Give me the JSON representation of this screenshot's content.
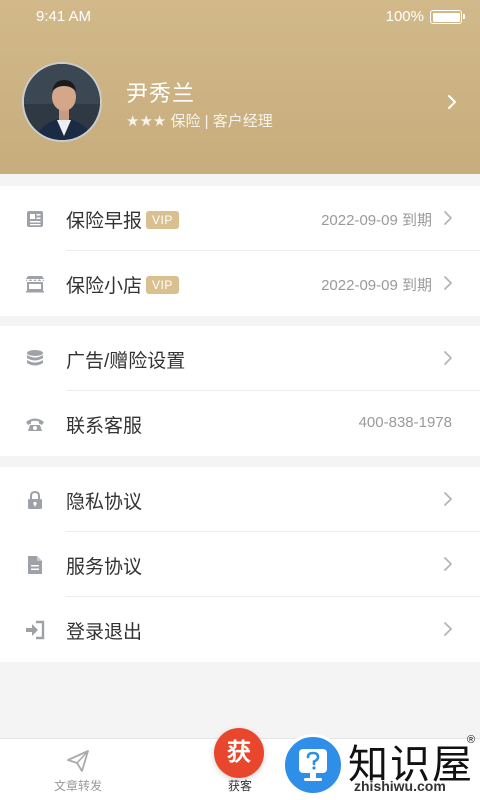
{
  "status_bar": {
    "time": "9:41 AM",
    "battery": "100%",
    "battery_level": 1.0
  },
  "profile": {
    "name": "尹秀兰",
    "subtitle": "★★★ 保险 | 客户经理"
  },
  "sections": [
    {
      "items": [
        {
          "label": "保险早报",
          "badge": "VIP",
          "value": "2022-09-09 到期",
          "icon": "newspaper-icon"
        },
        {
          "label": "保险小店",
          "badge": "VIP",
          "value": "2022-09-09 到期",
          "icon": "store-icon"
        }
      ]
    },
    {
      "items": [
        {
          "label": "广告/赠险设置",
          "icon": "database-icon"
        },
        {
          "label": "联系客服",
          "value": "400-838-1978",
          "icon": "phone-icon"
        }
      ]
    },
    {
      "items": [
        {
          "label": "隐私协议",
          "icon": "lock-icon"
        },
        {
          "label": "服务协议",
          "icon": "document-icon"
        },
        {
          "label": "登录退出",
          "icon": "sign-out-icon"
        }
      ]
    }
  ],
  "tabbar": {
    "tabs": [
      {
        "label": "文章转发",
        "icon": "paper-plane-icon"
      },
      {
        "label": "获客",
        "fab_glyph": "获"
      }
    ]
  },
  "watermark": {
    "title": "知识屋",
    "site": "zhishiwu.com",
    "reg": "®"
  },
  "colors": {
    "header": "#cdb482",
    "vip": "#d8c08f",
    "fab": "#e8472e",
    "watermark_blue": "#2f8fe8"
  }
}
